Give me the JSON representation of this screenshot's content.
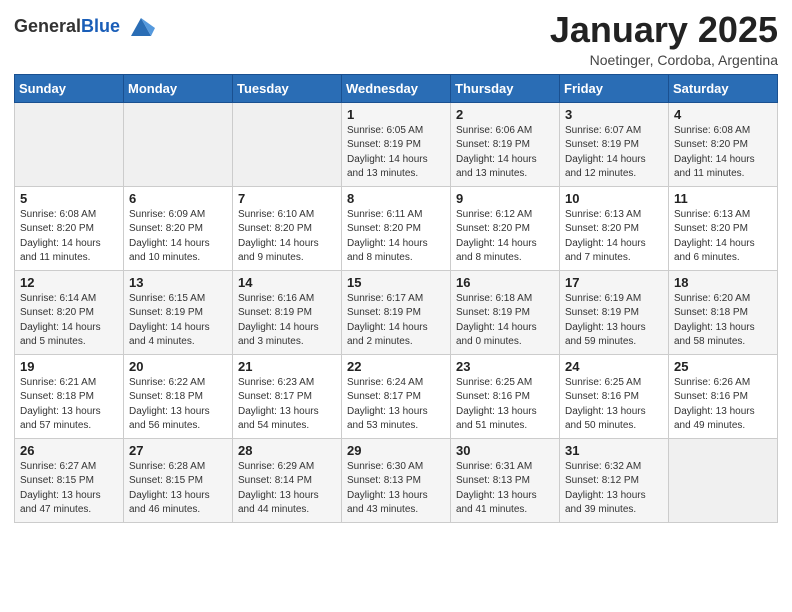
{
  "header": {
    "logo_general": "General",
    "logo_blue": "Blue",
    "month_title": "January 2025",
    "location": "Noetinger, Cordoba, Argentina"
  },
  "weekdays": [
    "Sunday",
    "Monday",
    "Tuesday",
    "Wednesday",
    "Thursday",
    "Friday",
    "Saturday"
  ],
  "weeks": [
    [
      {
        "day": "",
        "sunrise": "",
        "sunset": "",
        "daylight": ""
      },
      {
        "day": "",
        "sunrise": "",
        "sunset": "",
        "daylight": ""
      },
      {
        "day": "",
        "sunrise": "",
        "sunset": "",
        "daylight": ""
      },
      {
        "day": "1",
        "sunrise": "Sunrise: 6:05 AM",
        "sunset": "Sunset: 8:19 PM",
        "daylight": "Daylight: 14 hours and 13 minutes."
      },
      {
        "day": "2",
        "sunrise": "Sunrise: 6:06 AM",
        "sunset": "Sunset: 8:19 PM",
        "daylight": "Daylight: 14 hours and 13 minutes."
      },
      {
        "day": "3",
        "sunrise": "Sunrise: 6:07 AM",
        "sunset": "Sunset: 8:19 PM",
        "daylight": "Daylight: 14 hours and 12 minutes."
      },
      {
        "day": "4",
        "sunrise": "Sunrise: 6:08 AM",
        "sunset": "Sunset: 8:20 PM",
        "daylight": "Daylight: 14 hours and 11 minutes."
      }
    ],
    [
      {
        "day": "5",
        "sunrise": "Sunrise: 6:08 AM",
        "sunset": "Sunset: 8:20 PM",
        "daylight": "Daylight: 14 hours and 11 minutes."
      },
      {
        "day": "6",
        "sunrise": "Sunrise: 6:09 AM",
        "sunset": "Sunset: 8:20 PM",
        "daylight": "Daylight: 14 hours and 10 minutes."
      },
      {
        "day": "7",
        "sunrise": "Sunrise: 6:10 AM",
        "sunset": "Sunset: 8:20 PM",
        "daylight": "Daylight: 14 hours and 9 minutes."
      },
      {
        "day": "8",
        "sunrise": "Sunrise: 6:11 AM",
        "sunset": "Sunset: 8:20 PM",
        "daylight": "Daylight: 14 hours and 8 minutes."
      },
      {
        "day": "9",
        "sunrise": "Sunrise: 6:12 AM",
        "sunset": "Sunset: 8:20 PM",
        "daylight": "Daylight: 14 hours and 8 minutes."
      },
      {
        "day": "10",
        "sunrise": "Sunrise: 6:13 AM",
        "sunset": "Sunset: 8:20 PM",
        "daylight": "Daylight: 14 hours and 7 minutes."
      },
      {
        "day": "11",
        "sunrise": "Sunrise: 6:13 AM",
        "sunset": "Sunset: 8:20 PM",
        "daylight": "Daylight: 14 hours and 6 minutes."
      }
    ],
    [
      {
        "day": "12",
        "sunrise": "Sunrise: 6:14 AM",
        "sunset": "Sunset: 8:20 PM",
        "daylight": "Daylight: 14 hours and 5 minutes."
      },
      {
        "day": "13",
        "sunrise": "Sunrise: 6:15 AM",
        "sunset": "Sunset: 8:19 PM",
        "daylight": "Daylight: 14 hours and 4 minutes."
      },
      {
        "day": "14",
        "sunrise": "Sunrise: 6:16 AM",
        "sunset": "Sunset: 8:19 PM",
        "daylight": "Daylight: 14 hours and 3 minutes."
      },
      {
        "day": "15",
        "sunrise": "Sunrise: 6:17 AM",
        "sunset": "Sunset: 8:19 PM",
        "daylight": "Daylight: 14 hours and 2 minutes."
      },
      {
        "day": "16",
        "sunrise": "Sunrise: 6:18 AM",
        "sunset": "Sunset: 8:19 PM",
        "daylight": "Daylight: 14 hours and 0 minutes."
      },
      {
        "day": "17",
        "sunrise": "Sunrise: 6:19 AM",
        "sunset": "Sunset: 8:19 PM",
        "daylight": "Daylight: 13 hours and 59 minutes."
      },
      {
        "day": "18",
        "sunrise": "Sunrise: 6:20 AM",
        "sunset": "Sunset: 8:18 PM",
        "daylight": "Daylight: 13 hours and 58 minutes."
      }
    ],
    [
      {
        "day": "19",
        "sunrise": "Sunrise: 6:21 AM",
        "sunset": "Sunset: 8:18 PM",
        "daylight": "Daylight: 13 hours and 57 minutes."
      },
      {
        "day": "20",
        "sunrise": "Sunrise: 6:22 AM",
        "sunset": "Sunset: 8:18 PM",
        "daylight": "Daylight: 13 hours and 56 minutes."
      },
      {
        "day": "21",
        "sunrise": "Sunrise: 6:23 AM",
        "sunset": "Sunset: 8:17 PM",
        "daylight": "Daylight: 13 hours and 54 minutes."
      },
      {
        "day": "22",
        "sunrise": "Sunrise: 6:24 AM",
        "sunset": "Sunset: 8:17 PM",
        "daylight": "Daylight: 13 hours and 53 minutes."
      },
      {
        "day": "23",
        "sunrise": "Sunrise: 6:25 AM",
        "sunset": "Sunset: 8:16 PM",
        "daylight": "Daylight: 13 hours and 51 minutes."
      },
      {
        "day": "24",
        "sunrise": "Sunrise: 6:25 AM",
        "sunset": "Sunset: 8:16 PM",
        "daylight": "Daylight: 13 hours and 50 minutes."
      },
      {
        "day": "25",
        "sunrise": "Sunrise: 6:26 AM",
        "sunset": "Sunset: 8:16 PM",
        "daylight": "Daylight: 13 hours and 49 minutes."
      }
    ],
    [
      {
        "day": "26",
        "sunrise": "Sunrise: 6:27 AM",
        "sunset": "Sunset: 8:15 PM",
        "daylight": "Daylight: 13 hours and 47 minutes."
      },
      {
        "day": "27",
        "sunrise": "Sunrise: 6:28 AM",
        "sunset": "Sunset: 8:15 PM",
        "daylight": "Daylight: 13 hours and 46 minutes."
      },
      {
        "day": "28",
        "sunrise": "Sunrise: 6:29 AM",
        "sunset": "Sunset: 8:14 PM",
        "daylight": "Daylight: 13 hours and 44 minutes."
      },
      {
        "day": "29",
        "sunrise": "Sunrise: 6:30 AM",
        "sunset": "Sunset: 8:13 PM",
        "daylight": "Daylight: 13 hours and 43 minutes."
      },
      {
        "day": "30",
        "sunrise": "Sunrise: 6:31 AM",
        "sunset": "Sunset: 8:13 PM",
        "daylight": "Daylight: 13 hours and 41 minutes."
      },
      {
        "day": "31",
        "sunrise": "Sunrise: 6:32 AM",
        "sunset": "Sunset: 8:12 PM",
        "daylight": "Daylight: 13 hours and 39 minutes."
      },
      {
        "day": "",
        "sunrise": "",
        "sunset": "",
        "daylight": ""
      }
    ]
  ]
}
